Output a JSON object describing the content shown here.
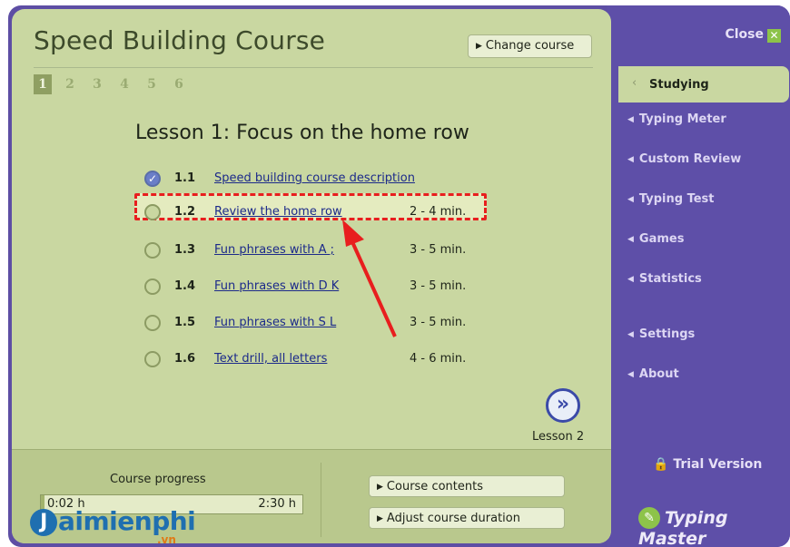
{
  "header": {
    "title": "Speed Building Course",
    "change_course": "Change course"
  },
  "page_tabs": [
    "1",
    "2",
    "3",
    "4",
    "5",
    "6"
  ],
  "lesson": {
    "title": "Lesson 1: Focus on the home row",
    "items": [
      {
        "num": "1.1",
        "label": "Speed building course description",
        "duration": "",
        "checked": true
      },
      {
        "num": "1.2",
        "label": "Review the home row",
        "duration": "2 - 4 min.",
        "checked": false
      },
      {
        "num": "1.3",
        "label": "Fun phrases with A ;",
        "duration": "3 - 5 min.",
        "checked": false
      },
      {
        "num": "1.4",
        "label": "Fun phrases with D K",
        "duration": "3 - 5 min.",
        "checked": false
      },
      {
        "num": "1.5",
        "label": "Fun phrases with S L",
        "duration": "3 - 5 min.",
        "checked": false
      },
      {
        "num": "1.6",
        "label": "Text drill, all letters",
        "duration": "4 - 6 min.",
        "checked": false
      }
    ],
    "next_label": "Lesson 2"
  },
  "footer": {
    "progress_label": "Course progress",
    "progress_start": "0:02 h",
    "progress_end": "2:30 h",
    "progress_fraction": 0.013,
    "course_contents": "Course contents",
    "adjust_duration": "Adjust course duration"
  },
  "sidebar": {
    "close": "Close",
    "active": "Studying",
    "items": [
      "Typing Meter",
      "Custom Review",
      "Typing Test",
      "Games",
      "Statistics",
      "Settings",
      "About"
    ],
    "trial": "Trial Version",
    "brand": "Typing Master"
  },
  "watermark": {
    "brand": "aimienphi",
    "sub": ".vn"
  },
  "colors": {
    "panel": "#c9d7a1",
    "sidebar": "#5e4fa8",
    "highlight": "#e81e1e"
  }
}
